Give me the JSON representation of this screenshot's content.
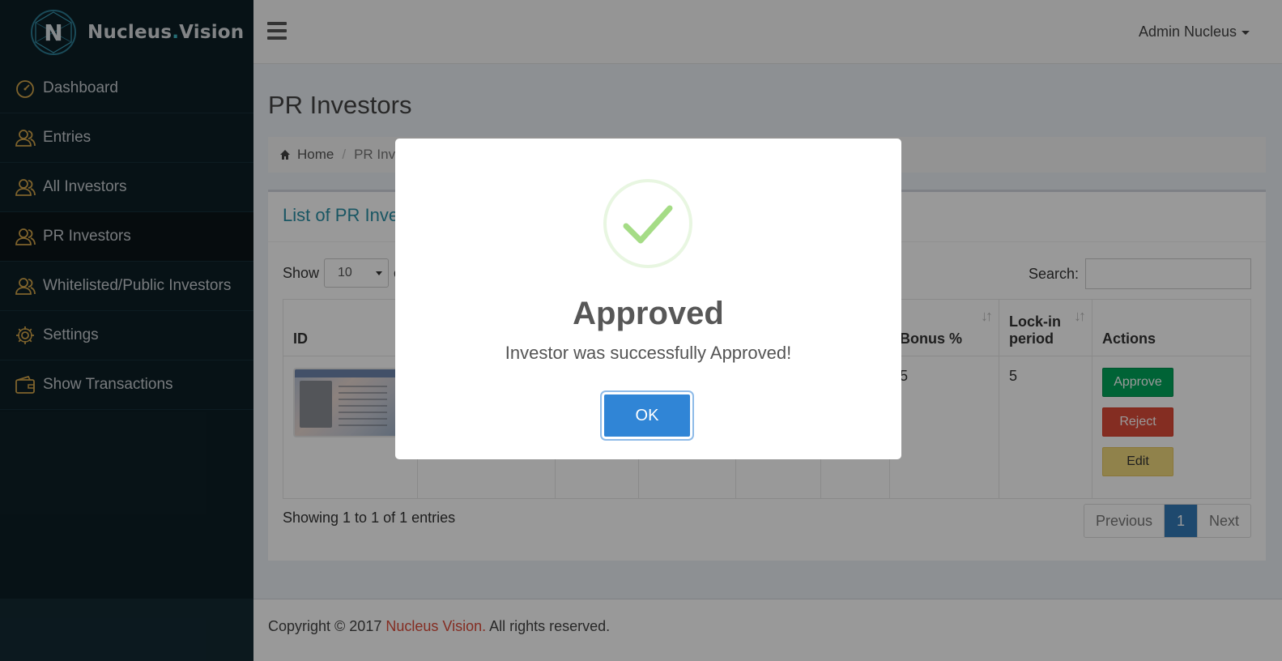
{
  "app": {
    "logo_text_main": "Nucleus",
    "logo_text_dot": ".",
    "logo_text_end": "Vision"
  },
  "sidebar": {
    "items": [
      {
        "label": "Dashboard",
        "icon": "dashboard-gauge-icon",
        "active": false
      },
      {
        "label": "Entries",
        "icon": "users-icon",
        "active": false
      },
      {
        "label": "All Investors",
        "icon": "users-icon",
        "active": false
      },
      {
        "label": "PR Investors",
        "icon": "users-icon",
        "active": true
      },
      {
        "label": "Whitelisted/Public Investors",
        "icon": "users-icon",
        "active": false
      },
      {
        "label": "Settings",
        "icon": "gear-icon",
        "active": false
      },
      {
        "label": "Show Transactions",
        "icon": "wallet-icon",
        "active": false
      }
    ]
  },
  "header": {
    "user_name": "Admin Nucleus"
  },
  "page": {
    "title": "PR Investors",
    "breadcrumb": {
      "home": "Home",
      "current": "PR Inve"
    },
    "box_title": "List of PR Inve",
    "show_label": "Show",
    "show_tail": "e",
    "page_length": "10",
    "search_label": "Search:",
    "search_value": ""
  },
  "table": {
    "headers": [
      {
        "label": "ID",
        "sortable": false
      },
      {
        "label": "",
        "sortable": false
      },
      {
        "label": "",
        "sortable": false
      },
      {
        "label": "",
        "sortable": false
      },
      {
        "label": "",
        "sortable": false
      },
      {
        "label": "",
        "sortable": false
      },
      {
        "label": "Bonus %",
        "sortable": true
      },
      {
        "label": "Lock-in period",
        "sortable": true
      },
      {
        "label": "Actions",
        "sortable": false
      }
    ],
    "rows": [
      {
        "bonus": "5",
        "lockin": "5"
      }
    ],
    "actions": {
      "approve": "Approve",
      "reject": "Reject",
      "edit": "Edit"
    }
  },
  "pagination": {
    "info": "Showing 1 to 1 of 1 entries",
    "previous": "Previous",
    "current": "1",
    "next": "Next"
  },
  "footer": {
    "prefix": "Copyright © 2017 ",
    "brand": "Nucleus Vision.",
    "suffix": " All rights reserved."
  },
  "modal": {
    "title": "Approved",
    "text": "Investor was successfully Approved!",
    "ok_label": "OK",
    "icon": "success-check-icon"
  },
  "colors": {
    "sidebar_bg": "#0d1f26",
    "accent_title": "#2a8fa6",
    "approve": "#00a65a",
    "reject": "#dd4b39",
    "edit": "#f1d97e",
    "ok_button": "#3085d6",
    "success_check": "#a5dc86"
  }
}
